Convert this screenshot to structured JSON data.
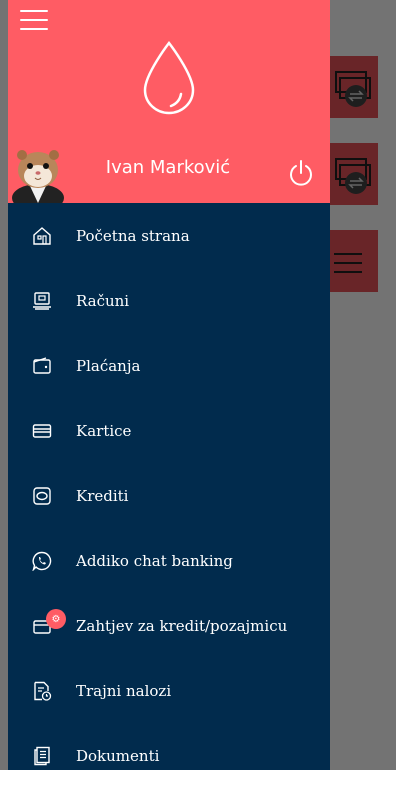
{
  "header": {
    "user_name": "Ivan Marković",
    "accent_color": "#ff5c64",
    "logo_icon": "drop-icon",
    "avatar_icon": "hamster-avatar"
  },
  "menu": {
    "items": [
      {
        "label": "Početna strana",
        "icon": "home-icon"
      },
      {
        "label": "Računi",
        "icon": "accounts-icon"
      },
      {
        "label": "Plaćanja",
        "icon": "wallet-icon"
      },
      {
        "label": "Kartice",
        "icon": "card-icon"
      },
      {
        "label": "Krediti",
        "icon": "loan-icon"
      },
      {
        "label": "Addiko chat banking",
        "icon": "chat-phone-icon"
      },
      {
        "label": "Zahtjev za kredit/pozajmicu",
        "icon": "loan-request-icon",
        "badge_icon": "gear-icon"
      },
      {
        "label": "Trajni nalozi",
        "icon": "standing-order-icon"
      },
      {
        "label": "Dokumenti",
        "icon": "documents-icon"
      }
    ],
    "background_color": "#012b4d"
  }
}
